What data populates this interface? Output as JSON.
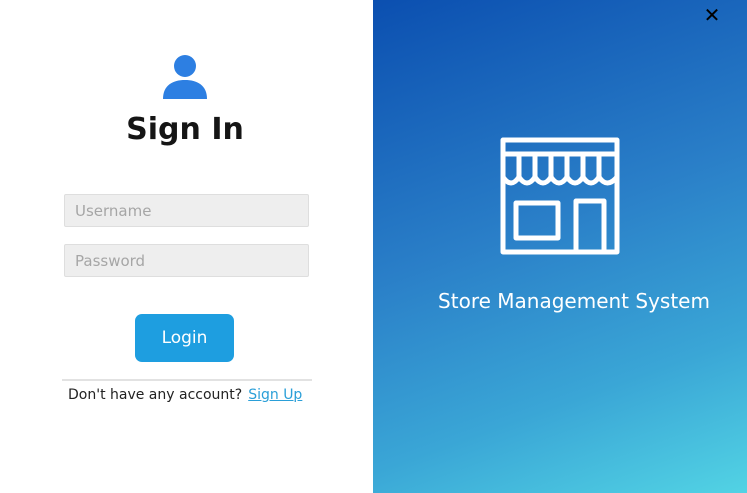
{
  "login": {
    "title": "Sign In",
    "username_placeholder": "Username",
    "password_placeholder": "Password",
    "login_label": "Login",
    "signup_prompt": "Don't have any account?",
    "signup_link": "Sign Up",
    "user_icon": "user-icon"
  },
  "window": {
    "close_label": "✕",
    "close_icon": "close-icon"
  },
  "brand": {
    "name": "Store Management System",
    "store_icon": "storefront-icon"
  },
  "colors": {
    "accent": "#1e9ee0",
    "link": "#2a9fd8",
    "gradient_start": "#0b4fb0",
    "gradient_end": "#52d3e4"
  }
}
